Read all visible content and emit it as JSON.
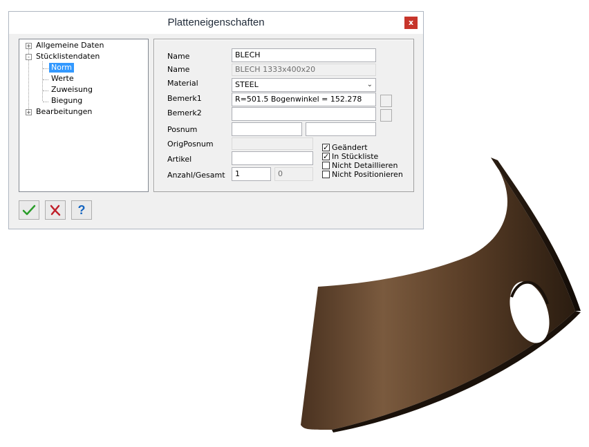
{
  "dialog": {
    "title": "Platteneigenschaften",
    "close_label": "x"
  },
  "tree": {
    "items": [
      {
        "label": "Allgemeine Daten",
        "expander": "+"
      },
      {
        "label": "Stücklistendaten",
        "expander": "-"
      },
      {
        "label": "Norm"
      },
      {
        "label": "Werte"
      },
      {
        "label": "Zuweisung"
      },
      {
        "label": "Biegung"
      },
      {
        "label": "Bearbeitungen",
        "expander": "+"
      }
    ],
    "selected": "Norm"
  },
  "form": {
    "name_label": "Name",
    "name_value": "BLECH",
    "name2_label": "Name",
    "name2_value": "BLECH  1333x400x20",
    "material_label": "Material",
    "material_value": "STEEL",
    "bemerk1_label": "Bemerk1",
    "bemerk1_value": "R=501.5 Bogenwinkel = 152.278",
    "bemerk2_label": "Bemerk2",
    "bemerk2_value": "",
    "posnum_label": "Posnum",
    "posnum_value": "",
    "posnum2_value": "",
    "origposnum_label": "OrigPosnum",
    "origposnum_value": "",
    "artikel_label": "Artikel",
    "artikel_value": "",
    "anzahl_label": "Anzahl/Gesamt",
    "anzahl_value": "1",
    "gesamt_value": "0"
  },
  "checkboxes": [
    {
      "label": "Geändert",
      "checked": true
    },
    {
      "label": "In Stückliste",
      "checked": true
    },
    {
      "label": "Nicht Detaillieren",
      "checked": false
    },
    {
      "label": "Nicht Positionieren",
      "checked": false
    }
  ],
  "buttons": {
    "ok_icon": "checkmark-icon",
    "cancel_icon": "cross-icon",
    "help_icon": "question-icon",
    "help_glyph": "?"
  },
  "colors": {
    "ok_green": "#2a9d2a",
    "cancel_red": "#c0202a",
    "help_blue": "#1565c0",
    "selection": "#3399ff",
    "close_red": "#c7352b",
    "model_brown": "#6b4a2f"
  }
}
